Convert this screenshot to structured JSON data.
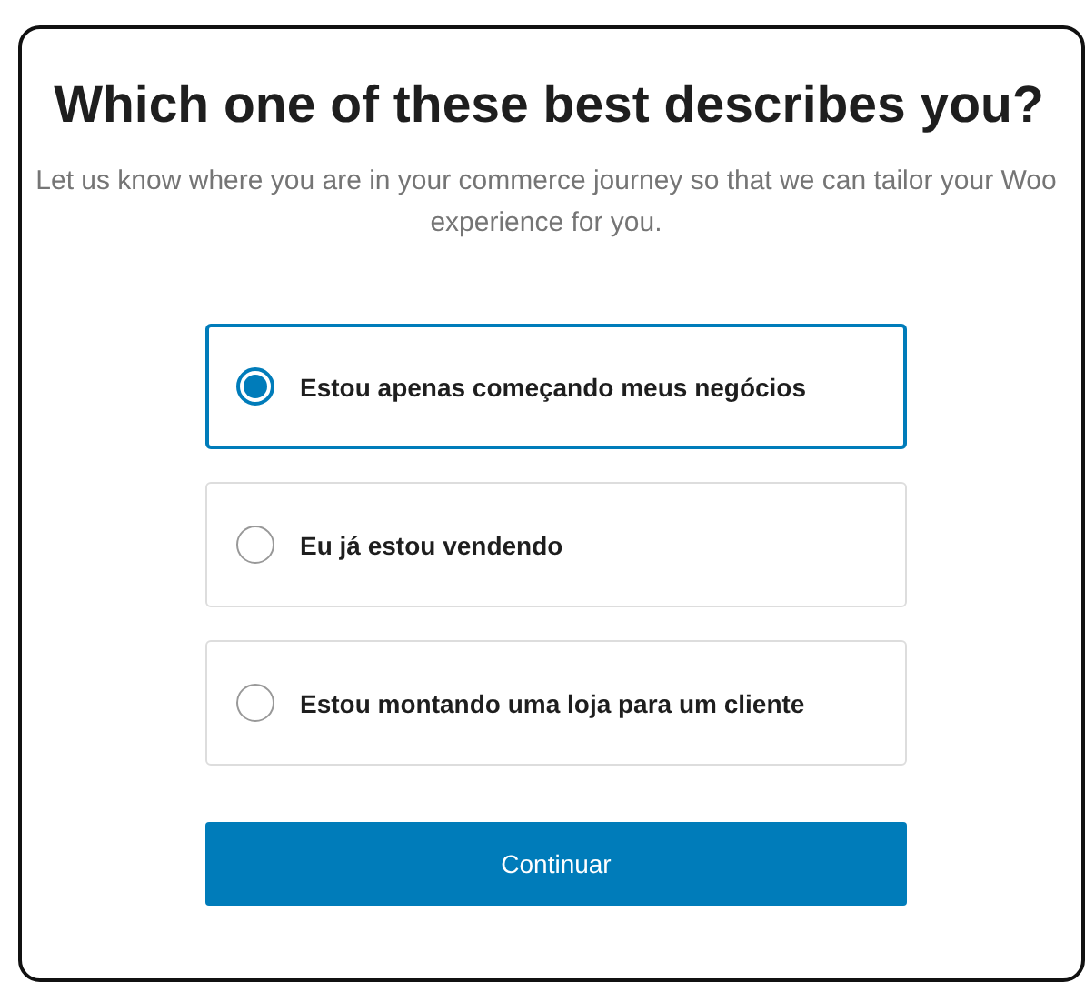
{
  "heading": "Which one of these best describes you?",
  "subtitle_lines": [
    "Let us know where you are in your commerce journey so that we can tailor your Woo",
    "experience for you."
  ],
  "options": [
    {
      "label": "Estou apenas começando meus negócios",
      "selected": true
    },
    {
      "label": "Eu já estou vendendo",
      "selected": false
    },
    {
      "label": "Estou montando uma loja para um cliente",
      "selected": false
    }
  ],
  "continue_button": "Continuar"
}
